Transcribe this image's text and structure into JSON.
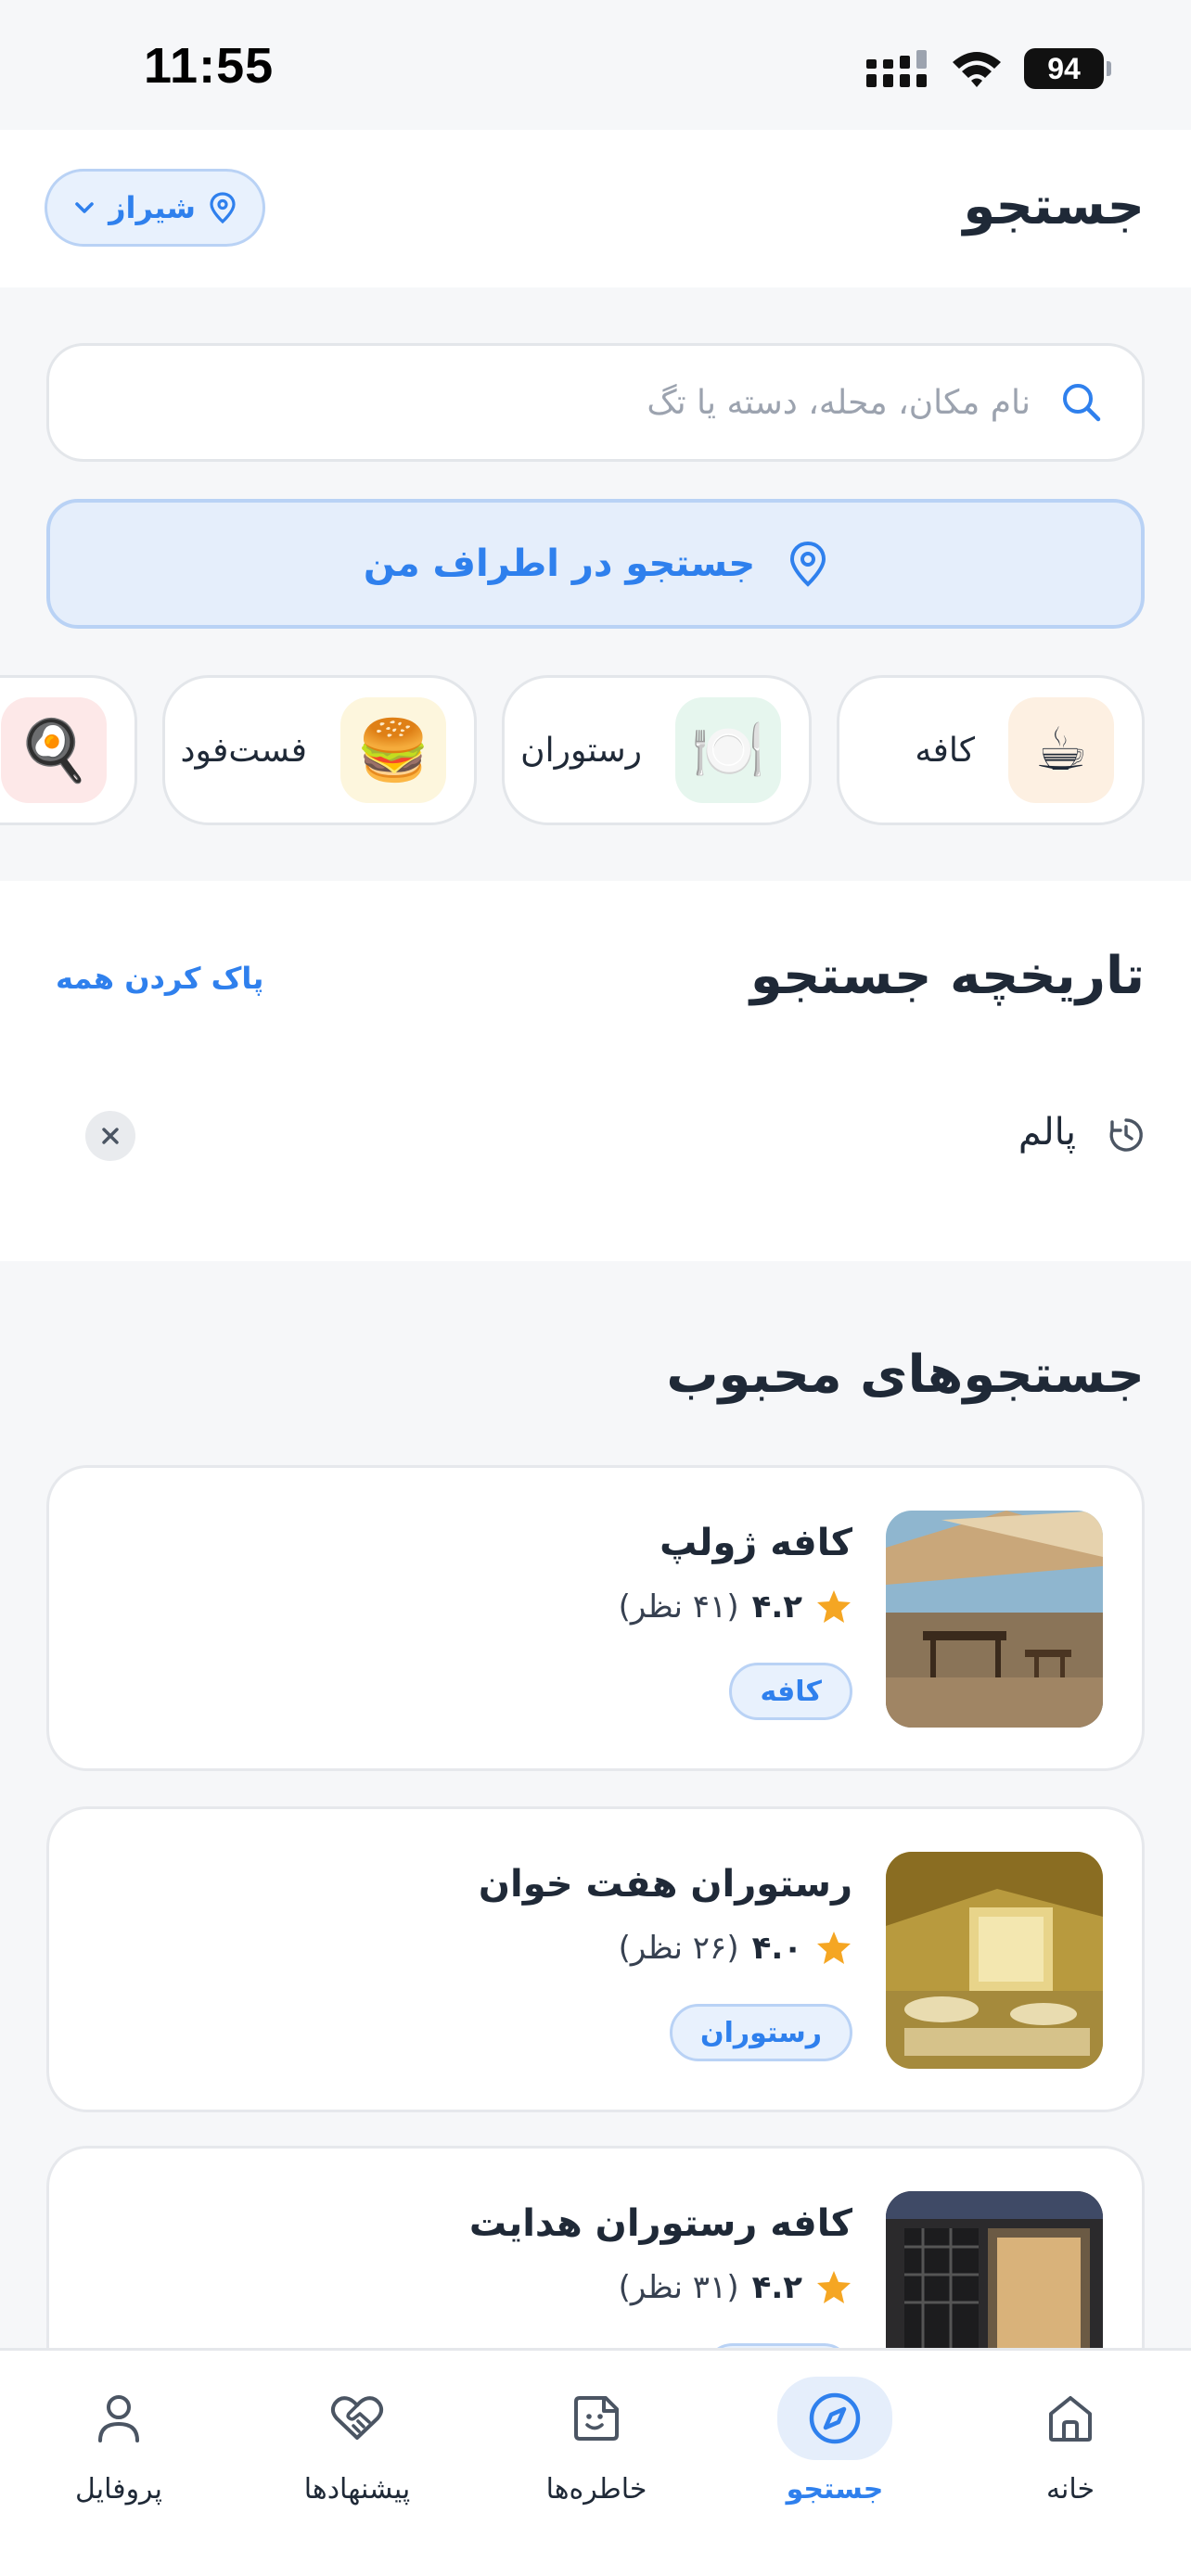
{
  "status_bar": {
    "time": "11:55",
    "battery": "94"
  },
  "header": {
    "title": "جستجو",
    "city": "شیراز"
  },
  "search": {
    "placeholder": "نام مکان، محله، دسته یا تگ",
    "value": ""
  },
  "nearby": {
    "label": "جستجو در اطراف من"
  },
  "categories": [
    {
      "label": "کافه",
      "emoji": "☕",
      "bg": "#fdf0e2"
    },
    {
      "label": "رستوران",
      "emoji": "🍽️",
      "bg": "#e6f6ee"
    },
    {
      "label": "فست‌فود",
      "emoji": "🍔",
      "bg": "#fdf6dd"
    },
    {
      "label": "",
      "emoji": "🍳",
      "bg": "#fde8e8"
    }
  ],
  "history": {
    "title": "تاریخچه جستجو",
    "clear_all": "پاک کردن همه",
    "items": [
      {
        "text": "پالم"
      }
    ]
  },
  "popular": {
    "title": "جستجوهای محبوب",
    "places": [
      {
        "name": "کافه ژولپ",
        "rating": "۴.۲",
        "reviews": "(۴۱ نظر)",
        "tag": "کافه"
      },
      {
        "name": "رستوران هفت خوان",
        "rating": "۴.۰",
        "reviews": "(۲۶ نظر)",
        "tag": "رستوران"
      },
      {
        "name": "کافه رستوران هدایت",
        "rating": "۴.۲",
        "reviews": "(۳۱ نظر)",
        "tag": ""
      }
    ]
  },
  "nav": {
    "home": "خانه",
    "search": "جستجو",
    "memories": "خاطره‌ها",
    "suggestions": "پیشنهادها",
    "profile": "پروفایل",
    "active": "search"
  },
  "colors": {
    "accent": "#2f80ed",
    "star": "#f5a623",
    "background": "#f6f7f9"
  }
}
